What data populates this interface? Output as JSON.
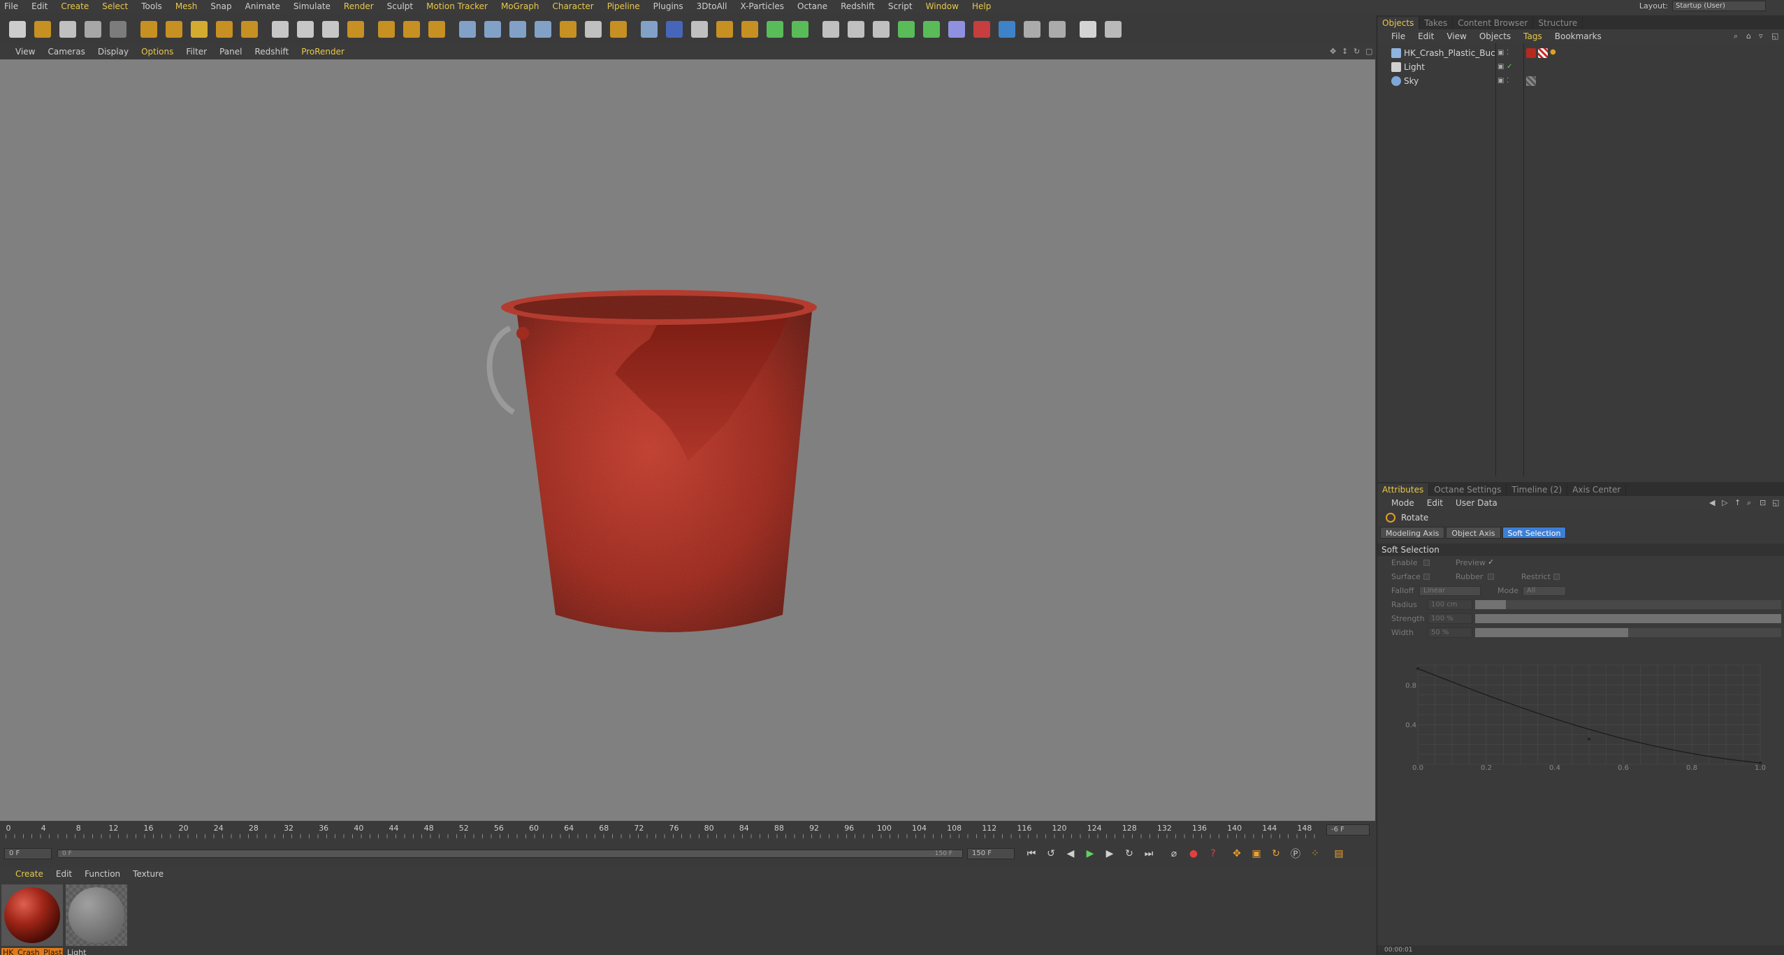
{
  "menubar": {
    "items": [
      {
        "label": "File",
        "hl": false
      },
      {
        "label": "Edit",
        "hl": false
      },
      {
        "label": "Create",
        "hl": true
      },
      {
        "label": "Select",
        "hl": true
      },
      {
        "label": "Tools",
        "hl": false
      },
      {
        "label": "Mesh",
        "hl": true
      },
      {
        "label": "Snap",
        "hl": false
      },
      {
        "label": "Animate",
        "hl": false
      },
      {
        "label": "Simulate",
        "hl": false
      },
      {
        "label": "Render",
        "hl": true
      },
      {
        "label": "Sculpt",
        "hl": false
      },
      {
        "label": "Motion Tracker",
        "hl": true
      },
      {
        "label": "MoGraph",
        "hl": true
      },
      {
        "label": "Character",
        "hl": true
      },
      {
        "label": "Pipeline",
        "hl": true
      },
      {
        "label": "Plugins",
        "hl": false
      },
      {
        "label": "3DtoAll",
        "hl": false
      },
      {
        "label": "X-Particles",
        "hl": false
      },
      {
        "label": "Octane",
        "hl": false
      },
      {
        "label": "Redshift",
        "hl": false
      },
      {
        "label": "Script",
        "hl": false
      },
      {
        "label": "Window",
        "hl": true
      },
      {
        "label": "Help",
        "hl": true
      }
    ],
    "layout_label": "Layout:",
    "layout_value": "Startup (User)"
  },
  "toolbar": {
    "icons": [
      "new-scene-icon",
      "open-icon",
      "open-recent-icon",
      "undo-icon",
      "redo-icon",
      "sep",
      "select-icon",
      "move-icon",
      "scale-icon",
      "rotate-icon",
      "recent-tool-icon",
      "sep",
      "x-axis-lock-icon",
      "y-axis-lock-icon",
      "z-axis-lock-icon",
      "coordinate-system-icon",
      "sep",
      "render-view-icon",
      "render-picture-viewer-icon",
      "edit-render-settings-icon",
      "sep",
      "cube-icon",
      "spline-icon",
      "generators-icon",
      "deformers-icon",
      "environment-icon",
      "cameras-icon",
      "lights-icon",
      "sep",
      "make-editable-icon",
      "model-mode-icon",
      "texture-mode-icon",
      "axis-mode-icon",
      "point-mode-icon",
      "edge-mode-icon",
      "polygon-mode-icon",
      "sep",
      "sculpt-icon",
      "paint-icon",
      "plugin-green-icon",
      "plugin-green2-icon",
      "knife-icon",
      "record-icon",
      "octane-icon",
      "hdr-icon",
      "xp-icon",
      "light-bulb-icon",
      "sep",
      "redshift-icon",
      "layout-grid-icon"
    ]
  },
  "viewport_menu": {
    "items": [
      {
        "label": "View",
        "hl": false
      },
      {
        "label": "Cameras",
        "hl": false
      },
      {
        "label": "Display",
        "hl": false
      },
      {
        "label": "Options",
        "hl": true
      },
      {
        "label": "Filter",
        "hl": false
      },
      {
        "label": "Panel",
        "hl": false
      },
      {
        "label": "Redshift",
        "hl": false
      },
      {
        "label": "ProRender",
        "hl": true
      }
    ]
  },
  "timeline": {
    "ticks": [
      "0",
      "4",
      "8",
      "12",
      "16",
      "20",
      "24",
      "28",
      "32",
      "36",
      "40",
      "44",
      "48",
      "52",
      "56",
      "60",
      "64",
      "68",
      "72",
      "76",
      "80",
      "84",
      "88",
      "92",
      "96",
      "100",
      "104",
      "108",
      "112",
      "116",
      "120",
      "124",
      "128",
      "132",
      "136",
      "140",
      "144",
      "148"
    ],
    "current_frame_display": "-6 F"
  },
  "transport": {
    "start_frame": "0 F",
    "range_start": "0 F",
    "range_end": "150 F",
    "end_frame": "150 F"
  },
  "material_manager": {
    "menu": [
      {
        "label": "Create",
        "hl": true
      },
      {
        "label": "Edit",
        "hl": false
      },
      {
        "label": "Function",
        "hl": false
      },
      {
        "label": "Texture",
        "hl": false
      }
    ],
    "materials": [
      {
        "name": "HK_Crash_Plastic",
        "selected": true
      },
      {
        "name": "Light",
        "selected": false
      }
    ]
  },
  "objects_panel": {
    "tabs": [
      {
        "label": "Objects",
        "active": true
      },
      {
        "label": "Takes",
        "active": false
      },
      {
        "label": "Content Browser",
        "active": false
      },
      {
        "label": "Structure",
        "active": false
      }
    ],
    "menu": [
      {
        "label": "File",
        "hl": false
      },
      {
        "label": "Edit",
        "hl": false
      },
      {
        "label": "View",
        "hl": false
      },
      {
        "label": "Objects",
        "hl": false
      },
      {
        "label": "Tags",
        "hl": true
      },
      {
        "label": "Bookmarks",
        "hl": false
      }
    ],
    "objects": [
      {
        "name": "HK_Crash_Plastic_Bucket",
        "icon": "polygon-object-icon",
        "color": "#8fb4e0"
      },
      {
        "name": "Light",
        "icon": "light-object-icon",
        "color": "#d0d0d0"
      },
      {
        "name": "Sky",
        "icon": "sky-object-icon",
        "color": "#7fa6d8"
      }
    ]
  },
  "attributes_panel": {
    "tabs": [
      {
        "label": "Attributes",
        "active": true
      },
      {
        "label": "Octane Settings",
        "active": false
      },
      {
        "label": "Timeline (2)",
        "active": false
      },
      {
        "label": "Axis Center",
        "active": false
      }
    ],
    "menu": [
      {
        "label": "Mode",
        "hl": false
      },
      {
        "label": "Edit",
        "hl": false
      },
      {
        "label": "User Data",
        "hl": false
      }
    ],
    "tool_name": "Rotate",
    "segments": [
      {
        "label": "Modeling Axis",
        "active": false
      },
      {
        "label": "Object Axis",
        "active": false
      },
      {
        "label": "Soft Selection",
        "active": true
      }
    ],
    "section": "Soft Selection",
    "enable_label": "Enable",
    "preview_label": "Preview",
    "surface_label": "Surface",
    "rubber_label": "Rubber",
    "restrict_label": "Restrict",
    "falloff_label": "Falloff",
    "falloff_value": "Linear",
    "mode_label": "Mode",
    "mode_value": "All",
    "radius_label": "Radius",
    "radius_value": "100 cm",
    "radius_fraction": 0.1,
    "strength_label": "Strength",
    "strength_value": "100 %",
    "strength_fraction": 1.0,
    "width_label": "Width",
    "width_value": "50 %",
    "width_fraction": 0.5,
    "graph": {
      "y_ticks": [
        "0.8",
        "0.4"
      ],
      "x_ticks": [
        "0.0",
        "0.2",
        "0.4",
        "0.6",
        "0.8",
        "1.0"
      ]
    },
    "status_text": "00:00:01"
  }
}
